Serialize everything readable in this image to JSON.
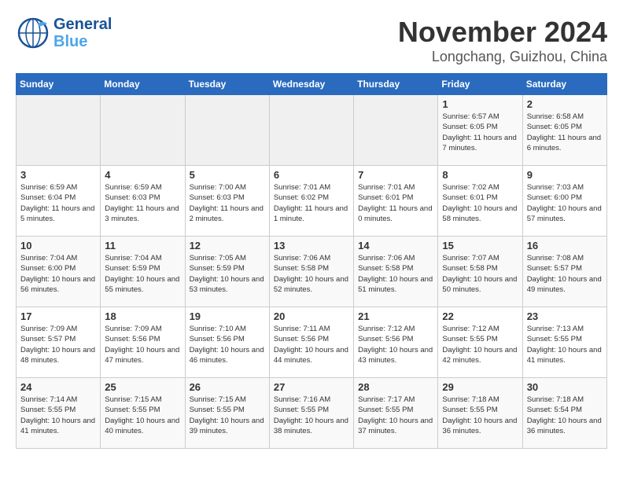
{
  "header": {
    "logo_line1": "General",
    "logo_line2": "Blue",
    "month": "November 2024",
    "location": "Longchang, Guizhou, China"
  },
  "weekdays": [
    "Sunday",
    "Monday",
    "Tuesday",
    "Wednesday",
    "Thursday",
    "Friday",
    "Saturday"
  ],
  "weeks": [
    [
      {
        "day": "",
        "info": ""
      },
      {
        "day": "",
        "info": ""
      },
      {
        "day": "",
        "info": ""
      },
      {
        "day": "",
        "info": ""
      },
      {
        "day": "",
        "info": ""
      },
      {
        "day": "1",
        "info": "Sunrise: 6:57 AM\nSunset: 6:05 PM\nDaylight: 11 hours and 7 minutes."
      },
      {
        "day": "2",
        "info": "Sunrise: 6:58 AM\nSunset: 6:05 PM\nDaylight: 11 hours and 6 minutes."
      }
    ],
    [
      {
        "day": "3",
        "info": "Sunrise: 6:59 AM\nSunset: 6:04 PM\nDaylight: 11 hours and 5 minutes."
      },
      {
        "day": "4",
        "info": "Sunrise: 6:59 AM\nSunset: 6:03 PM\nDaylight: 11 hours and 3 minutes."
      },
      {
        "day": "5",
        "info": "Sunrise: 7:00 AM\nSunset: 6:03 PM\nDaylight: 11 hours and 2 minutes."
      },
      {
        "day": "6",
        "info": "Sunrise: 7:01 AM\nSunset: 6:02 PM\nDaylight: 11 hours and 1 minute."
      },
      {
        "day": "7",
        "info": "Sunrise: 7:01 AM\nSunset: 6:01 PM\nDaylight: 11 hours and 0 minutes."
      },
      {
        "day": "8",
        "info": "Sunrise: 7:02 AM\nSunset: 6:01 PM\nDaylight: 10 hours and 58 minutes."
      },
      {
        "day": "9",
        "info": "Sunrise: 7:03 AM\nSunset: 6:00 PM\nDaylight: 10 hours and 57 minutes."
      }
    ],
    [
      {
        "day": "10",
        "info": "Sunrise: 7:04 AM\nSunset: 6:00 PM\nDaylight: 10 hours and 56 minutes."
      },
      {
        "day": "11",
        "info": "Sunrise: 7:04 AM\nSunset: 5:59 PM\nDaylight: 10 hours and 55 minutes."
      },
      {
        "day": "12",
        "info": "Sunrise: 7:05 AM\nSunset: 5:59 PM\nDaylight: 10 hours and 53 minutes."
      },
      {
        "day": "13",
        "info": "Sunrise: 7:06 AM\nSunset: 5:58 PM\nDaylight: 10 hours and 52 minutes."
      },
      {
        "day": "14",
        "info": "Sunrise: 7:06 AM\nSunset: 5:58 PM\nDaylight: 10 hours and 51 minutes."
      },
      {
        "day": "15",
        "info": "Sunrise: 7:07 AM\nSunset: 5:58 PM\nDaylight: 10 hours and 50 minutes."
      },
      {
        "day": "16",
        "info": "Sunrise: 7:08 AM\nSunset: 5:57 PM\nDaylight: 10 hours and 49 minutes."
      }
    ],
    [
      {
        "day": "17",
        "info": "Sunrise: 7:09 AM\nSunset: 5:57 PM\nDaylight: 10 hours and 48 minutes."
      },
      {
        "day": "18",
        "info": "Sunrise: 7:09 AM\nSunset: 5:56 PM\nDaylight: 10 hours and 47 minutes."
      },
      {
        "day": "19",
        "info": "Sunrise: 7:10 AM\nSunset: 5:56 PM\nDaylight: 10 hours and 46 minutes."
      },
      {
        "day": "20",
        "info": "Sunrise: 7:11 AM\nSunset: 5:56 PM\nDaylight: 10 hours and 44 minutes."
      },
      {
        "day": "21",
        "info": "Sunrise: 7:12 AM\nSunset: 5:56 PM\nDaylight: 10 hours and 43 minutes."
      },
      {
        "day": "22",
        "info": "Sunrise: 7:12 AM\nSunset: 5:55 PM\nDaylight: 10 hours and 42 minutes."
      },
      {
        "day": "23",
        "info": "Sunrise: 7:13 AM\nSunset: 5:55 PM\nDaylight: 10 hours and 41 minutes."
      }
    ],
    [
      {
        "day": "24",
        "info": "Sunrise: 7:14 AM\nSunset: 5:55 PM\nDaylight: 10 hours and 41 minutes."
      },
      {
        "day": "25",
        "info": "Sunrise: 7:15 AM\nSunset: 5:55 PM\nDaylight: 10 hours and 40 minutes."
      },
      {
        "day": "26",
        "info": "Sunrise: 7:15 AM\nSunset: 5:55 PM\nDaylight: 10 hours and 39 minutes."
      },
      {
        "day": "27",
        "info": "Sunrise: 7:16 AM\nSunset: 5:55 PM\nDaylight: 10 hours and 38 minutes."
      },
      {
        "day": "28",
        "info": "Sunrise: 7:17 AM\nSunset: 5:55 PM\nDaylight: 10 hours and 37 minutes."
      },
      {
        "day": "29",
        "info": "Sunrise: 7:18 AM\nSunset: 5:55 PM\nDaylight: 10 hours and 36 minutes."
      },
      {
        "day": "30",
        "info": "Sunrise: 7:18 AM\nSunset: 5:54 PM\nDaylight: 10 hours and 36 minutes."
      }
    ]
  ]
}
